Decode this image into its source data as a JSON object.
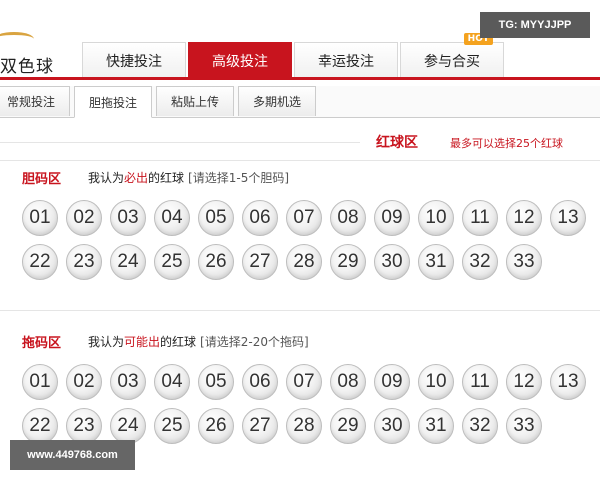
{
  "watermark_top": "TG: MYYJJPP",
  "watermark_bottom": "www.449768.com",
  "header": {
    "logo_text": "双色球",
    "tabs": [
      {
        "label": "快捷投注",
        "active": false
      },
      {
        "label": "高级投注",
        "active": true
      },
      {
        "label": "幸运投注",
        "active": false
      },
      {
        "label": "参与合买",
        "active": false,
        "badge": "HOT"
      }
    ]
  },
  "subtabs": [
    {
      "label": "常规投注",
      "active": false
    },
    {
      "label": "胆拖投注",
      "active": true
    },
    {
      "label": "粘贴上传",
      "active": false
    },
    {
      "label": "多期机选",
      "active": false
    }
  ],
  "red_zone": {
    "title": "红球区",
    "note": "最多可以选择25个红球"
  },
  "dan_zone": {
    "label": "胆码区",
    "desc_prefix": "我认为",
    "desc_highlight": "必出",
    "desc_suffix": "的红球",
    "hint": "[请选择1-5个胆码]",
    "balls": [
      "01",
      "02",
      "03",
      "04",
      "05",
      "06",
      "07",
      "08",
      "09",
      "10",
      "11",
      "12",
      "13",
      "22",
      "23",
      "24",
      "25",
      "26",
      "27",
      "28",
      "29",
      "30",
      "31",
      "32",
      "33"
    ]
  },
  "tuo_zone": {
    "label": "拖码区",
    "desc_prefix": "我认为",
    "desc_highlight": "可能出",
    "desc_suffix": "的红球",
    "hint": "[请选择2-20个拖码]",
    "balls": [
      "01",
      "02",
      "03",
      "04",
      "05",
      "06",
      "07",
      "08",
      "09",
      "10",
      "11",
      "12",
      "13",
      "22",
      "23",
      "24",
      "25",
      "26",
      "27",
      "28",
      "29",
      "30",
      "31",
      "32",
      "33"
    ]
  }
}
